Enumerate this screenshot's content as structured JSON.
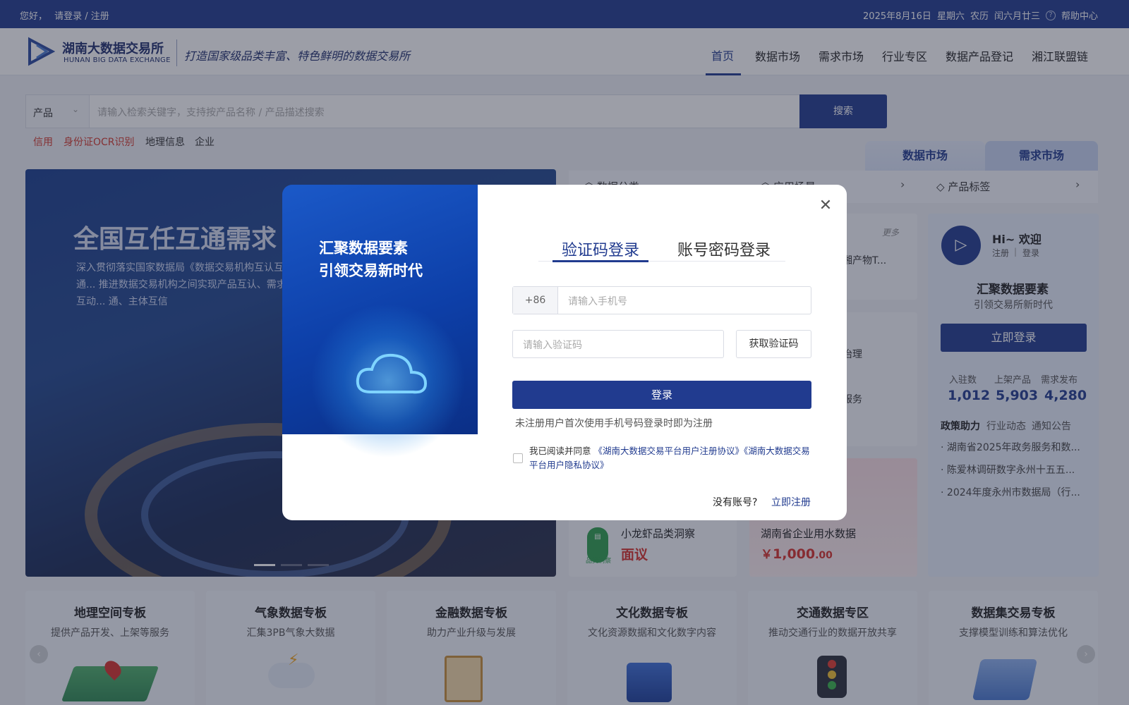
{
  "topbar": {
    "greeting": "您好，",
    "login_link": "请登录 / 注册",
    "date": "2025年8月16日",
    "weekday": "星期六",
    "lunar_label": "农历",
    "lunar_date": "闰六月廿三",
    "help": "帮助中心"
  },
  "logo": {
    "cn": "湖南大数据交易所",
    "en": "HUNAN BIG DATA EXCHANGE",
    "slogan": "打造国家级品类丰富、特色鲜明的数据交易所"
  },
  "nav": [
    "首页",
    "数据市场",
    "需求市场",
    "行业专区",
    "数据产品登记",
    "湘江联盟链"
  ],
  "search": {
    "category": "产品",
    "placeholder": "请输入检索关键字，支持按产品名称 / 产品描述搜索",
    "button": "搜索"
  },
  "hot_tags": [
    "信用",
    "身份证OCR识别",
    "地理信息",
    "企业"
  ],
  "banner": {
    "title": "全国互任互通需求",
    "desc": "深入贯彻落实国家数据局《数据交易机构互认互通... 推进数据交易机构之间实现产品互认、需求互动... 通、主体互信"
  },
  "market_tabs": {
    "data_market": "数据市场",
    "demand_market": "需求市场"
  },
  "categories": [
    "数据分类",
    "应用场景",
    "产品标签"
  ],
  "partial": {
    "more": "更多",
    "item1": "湘产物T...",
    "item2": "治理",
    "item3": "服务",
    "tag": "服务"
  },
  "products": [
    {
      "name": "小龙虾品类洞察",
      "price": "面议",
      "icon_label": "品类洞察"
    },
    {
      "name": "湖南省企业用水数据",
      "price_symbol": "￥",
      "price_int": "1,000",
      "price_dec": ".00"
    }
  ],
  "welcome": {
    "hi": "Hi~ 欢迎",
    "register": "注册",
    "login": "登录",
    "title": "汇聚数据要素",
    "subtitle": "引领交易所新时代",
    "login_btn": "立即登录",
    "stats": [
      {
        "label": "入驻数",
        "value": "1,012"
      },
      {
        "label": "上架产品",
        "value": "5,903"
      },
      {
        "label": "需求发布",
        "value": "4,280"
      }
    ],
    "news_tabs": [
      "政策助力",
      "行业动态",
      "通知公告"
    ],
    "news": [
      "湖南省2025年政务服务和数...",
      "陈爱林调研数字永州十五五...",
      "2024年度永州市数据局（行..."
    ]
  },
  "zones": [
    {
      "title": "地理空间专板",
      "sub": "提供产品开发、上架等服务"
    },
    {
      "title": "气象数据专板",
      "sub": "汇集3PB气象大数据"
    },
    {
      "title": "金融数据专板",
      "sub": "助力产业升级与发展"
    },
    {
      "title": "文化数据专板",
      "sub": "文化资源数据和文化数字内容"
    },
    {
      "title": "交通数据专区",
      "sub": "推动交通行业的数据开放共享"
    },
    {
      "title": "数据集交易专板",
      "sub": "支撑模型训练和算法优化"
    }
  ],
  "modal": {
    "left_line1": "汇聚数据要素",
    "left_line2": "引领交易新时代",
    "tab_sms": "验证码登录",
    "tab_pwd": "账号密码登录",
    "country_code": "+86",
    "phone_placeholder": "请输入手机号",
    "code_placeholder": "请输入验证码",
    "get_code": "获取验证码",
    "login": "登录",
    "hint": "未注册用户首次使用手机号码登录时即为注册",
    "agree_prefix": "我已阅读并同意",
    "agree_link1": "《湖南大数据交易平台用户注册协议》",
    "agree_link2": "《湖南大数据交易平台用户隐私协议》",
    "no_account": "没有账号?",
    "register_now": "立即注册"
  }
}
